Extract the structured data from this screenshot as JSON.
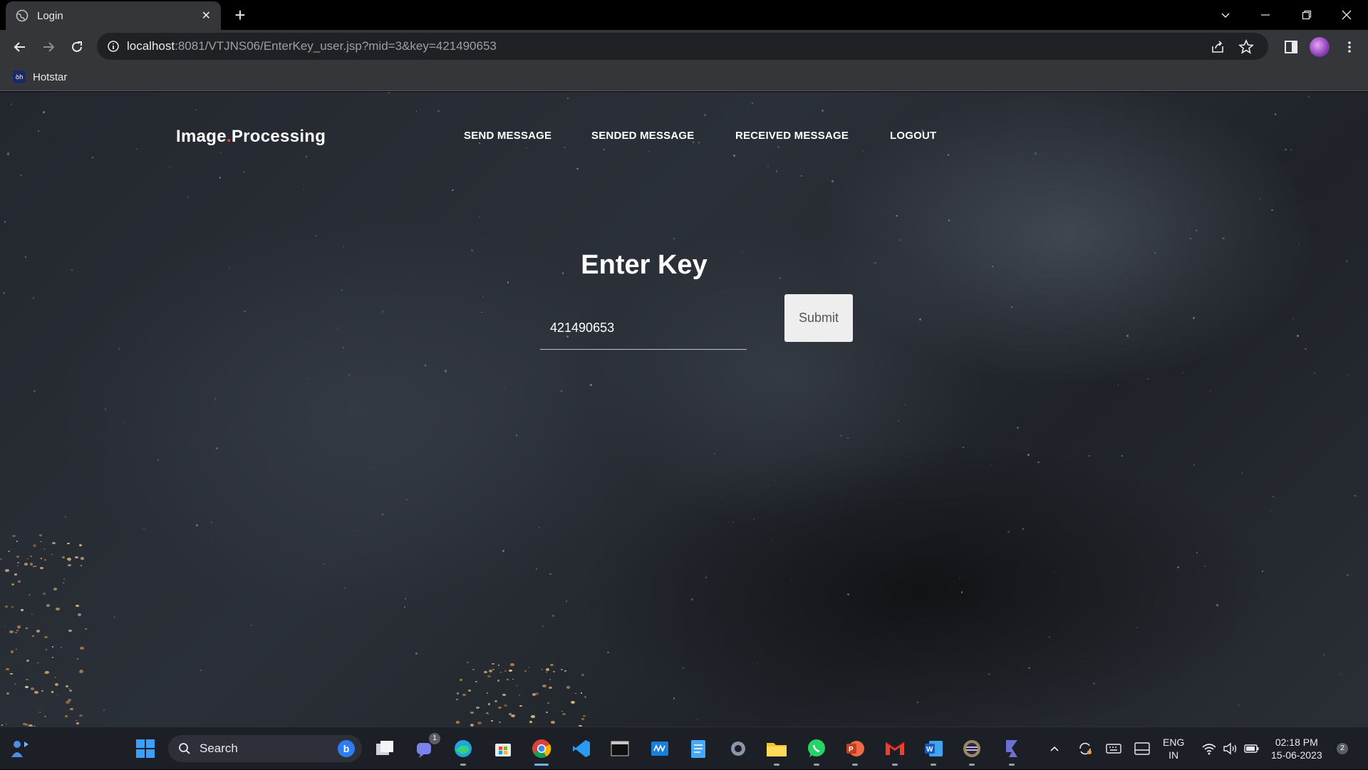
{
  "browser": {
    "tab_title": "Login",
    "url_host": "localhost",
    "url_rest": ":8081/VTJNS06/EnterKey_user.jsp?mid=3&key=421490653",
    "bookmark_label": "Hotstar",
    "bookmark_icon_text": "ꝺh"
  },
  "page": {
    "brand_part1": "Image",
    "brand_dot": ".",
    "brand_part2": "Processing",
    "nav": [
      {
        "label": "SEND MESSAGE"
      },
      {
        "label": "SENDED MESSAGE"
      },
      {
        "label": "RECEIVED MESSAGE"
      },
      {
        "label": "LOGOUT"
      }
    ],
    "form_title": "Enter Key",
    "key_value": "421490653",
    "submit_label": "Submit"
  },
  "taskbar": {
    "search_placeholder": "Search",
    "bing_letter": "b",
    "chat_badge": "1",
    "language_line1": "ENG",
    "language_line2": "IN",
    "time": "02:18 PM",
    "date": "15-06-2023",
    "notification_count": "2",
    "apps": [
      "widgets-icon",
      "start-icon",
      "task-view-icon",
      "teams-chat-icon",
      "edge-icon",
      "store-icon",
      "chrome-icon",
      "vscode-icon",
      "terminal-icon",
      "myhp-icon",
      "notepad-icon",
      "settings-icon",
      "file-explorer-icon",
      "whatsapp-icon",
      "powerpoint-icon",
      "gmail-icon",
      "word-icon",
      "eclipse-icon",
      "hotspot-icon"
    ]
  },
  "colors": {
    "brand_dot": "#e74c3c",
    "chrome_bg": "#35363a",
    "taskbar_bg": "#1c1f26"
  }
}
